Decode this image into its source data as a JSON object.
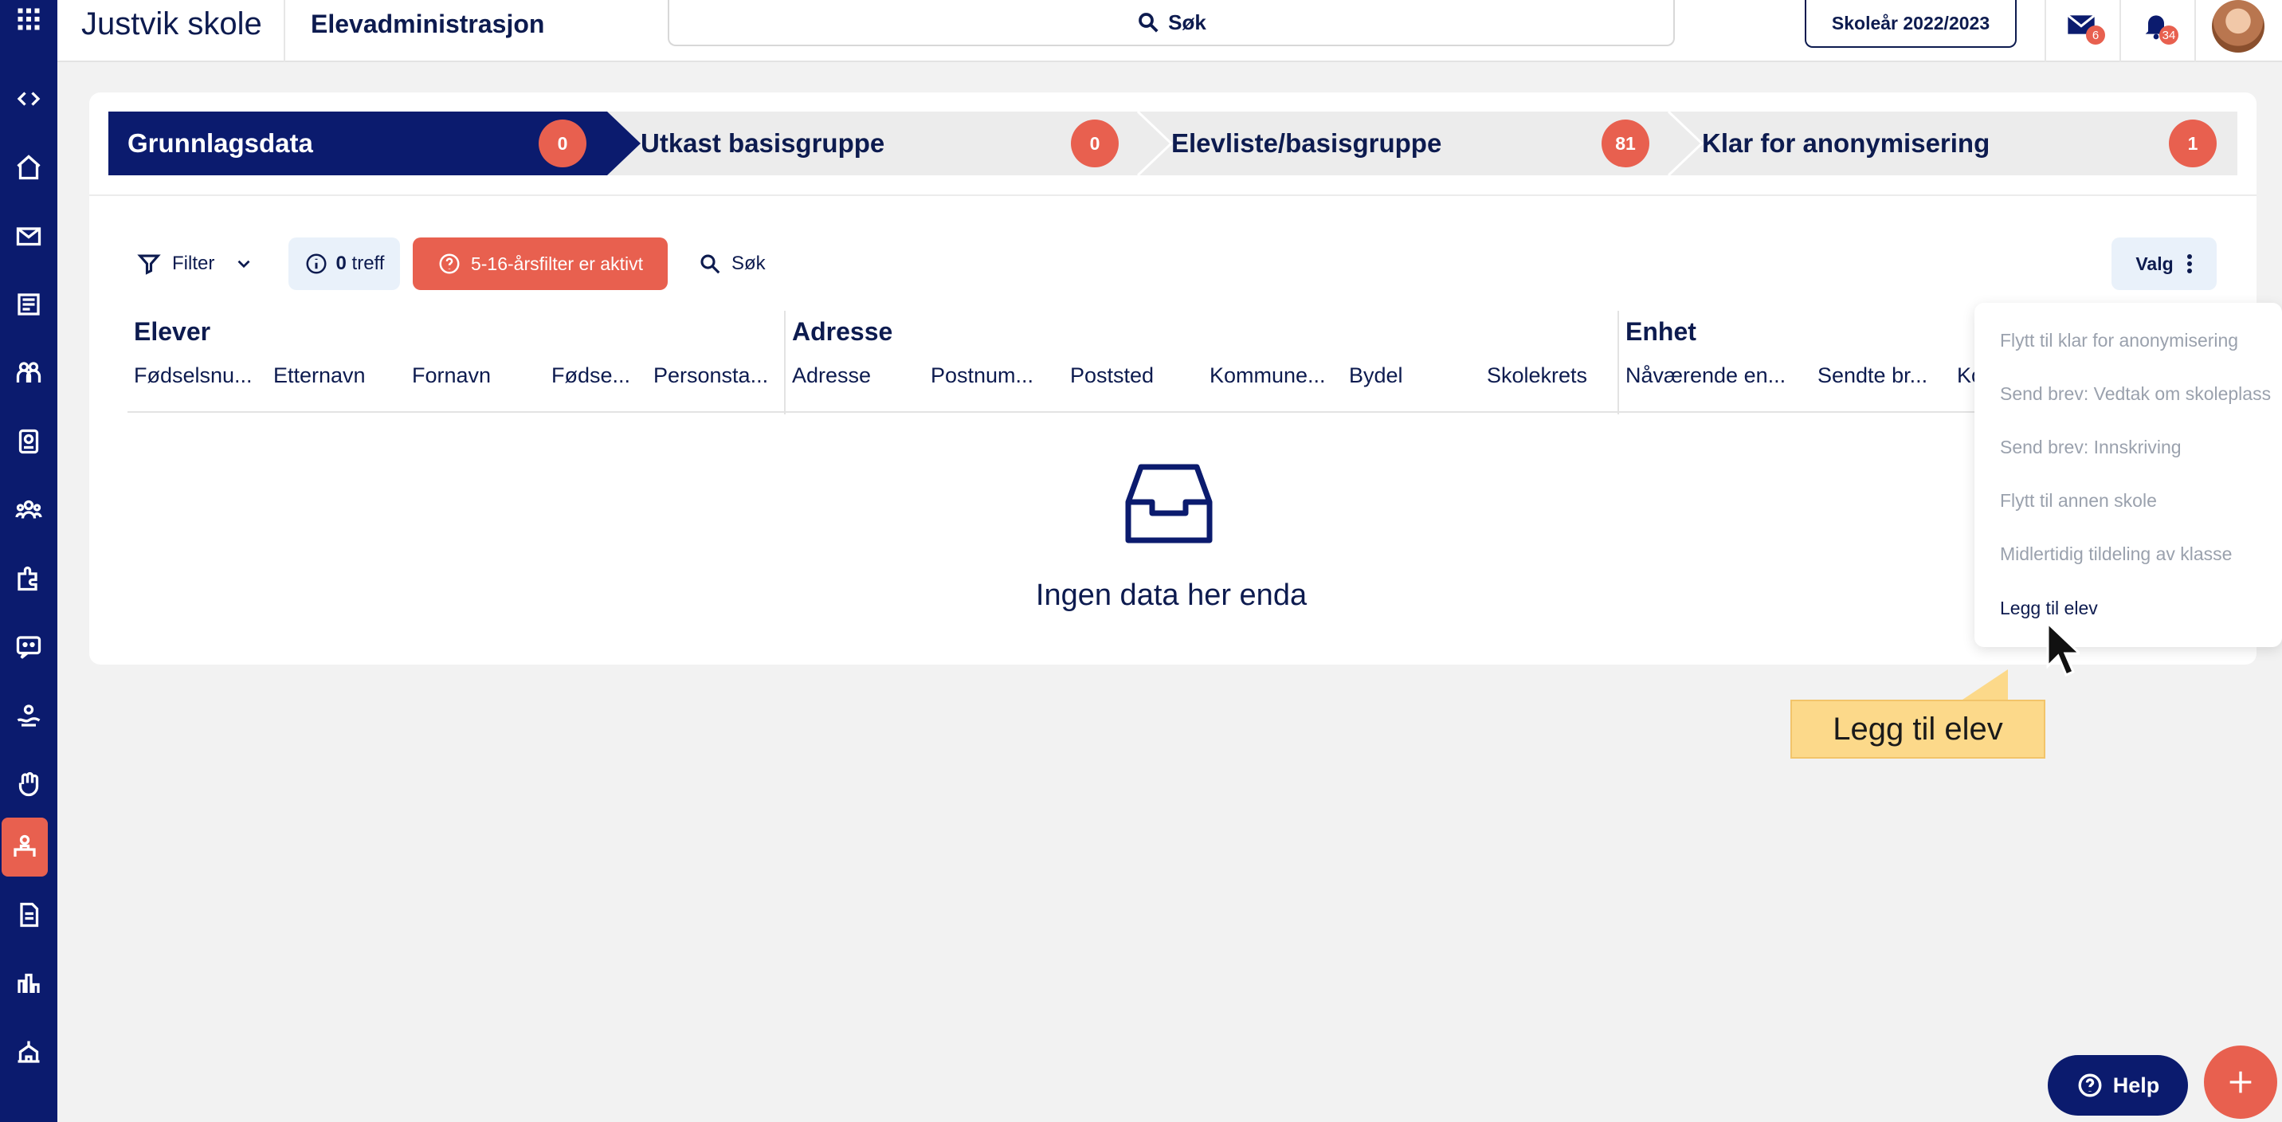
{
  "header": {
    "school_name": "Justvik skole",
    "module_title": "Elevadministrasjon",
    "search_label": "Søk",
    "school_year": "Skoleår 2022/2023",
    "mail_count": "6",
    "notification_count": "34"
  },
  "sidebar": {
    "icons": [
      "apps-grid-icon",
      "collapse-icon",
      "home-icon",
      "mail-icon",
      "news-icon",
      "people-icon",
      "badge-icon",
      "group-icon",
      "puzzle-icon",
      "chat-icon",
      "hand-heart-icon",
      "wave-icon",
      "student-admin-icon",
      "document-icon",
      "chart-icon",
      "school-icon"
    ],
    "active": "student-admin-icon"
  },
  "steps": [
    {
      "label": "Grunnlagsdata",
      "count": "0",
      "active": true
    },
    {
      "label": "Utkast basisgruppe",
      "count": "0",
      "active": false
    },
    {
      "label": "Elevliste/basisgruppe",
      "count": "81",
      "active": false
    },
    {
      "label": "Klar for anonymisering",
      "count": "1",
      "active": false
    }
  ],
  "toolbar": {
    "filter_label": "Filter",
    "hits_count": "0",
    "hits_label": "treff",
    "age_filter_label": "5-16-årsfilter er aktivt",
    "search_label": "Søk",
    "valg_label": "Valg"
  },
  "table": {
    "groups": [
      "Elever",
      "Adresse",
      "Enhet"
    ],
    "columns": [
      "Fødselsnu...",
      "Etternavn",
      "Fornavn",
      "Fødse...",
      "Personsta...",
      "Adresse",
      "Postnum...",
      "Poststed",
      "Kommune...",
      "Bydel",
      "Skolekrets",
      "Nåværende en...",
      "Sendte br...",
      "Ko"
    ],
    "empty_text": "Ingen data her enda"
  },
  "menu": {
    "items": [
      {
        "label": "Flytt til klar for anonymisering",
        "enabled": false
      },
      {
        "label": "Send brev: Vedtak om skoleplass",
        "enabled": false
      },
      {
        "label": "Send brev: Innskriving",
        "enabled": false
      },
      {
        "label": "Flytt til annen skole",
        "enabled": false
      },
      {
        "label": "Midlertidig tildeling av klasse",
        "enabled": false
      },
      {
        "label": "Legg til elev",
        "enabled": true
      }
    ]
  },
  "tooltip": {
    "text": "Legg til elev"
  },
  "help_label": "Help",
  "colors": {
    "navy": "#0b1b6e",
    "accent": "#e8604f",
    "tooltip": "#fcd98a"
  }
}
